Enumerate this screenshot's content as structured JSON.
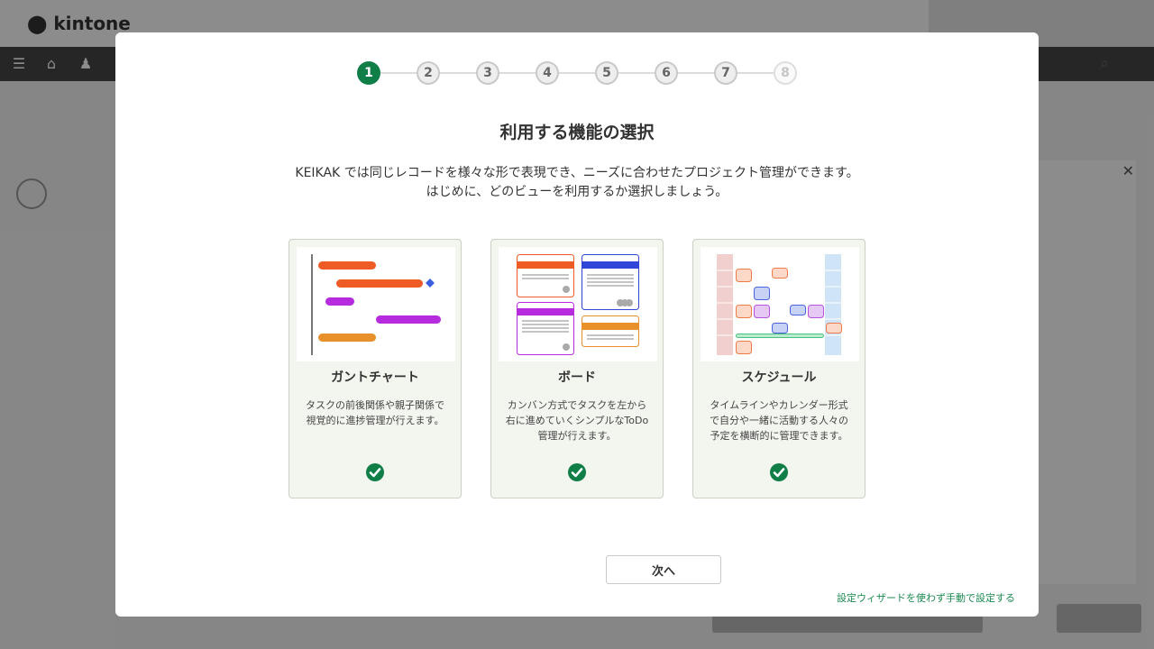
{
  "background": {
    "logo": "kintone",
    "user_name": "",
    "breadcrumb": "",
    "page_title": "",
    "section_label": "",
    "small_text": ""
  },
  "stepper": {
    "steps": [
      "1",
      "2",
      "3",
      "4",
      "5",
      "6",
      "7",
      "8"
    ],
    "current": 1
  },
  "modal": {
    "title": "利用する機能の選択",
    "desc_line1": "KEIKAK では同じレコードを様々な形で表現でき、ニーズに合わせたプロジェクト管理ができます。",
    "desc_line2": "はじめに、どのビューを利用するか選択しましょう。",
    "cards": [
      {
        "title": "ガントチャート",
        "desc_line1": "タスクの前後関係や親子関係で",
        "desc_line2": "視覚的に進捗管理が行えます。",
        "desc_line3": "",
        "icon": "gantt-chart-illustration",
        "selected": true
      },
      {
        "title": "ボード",
        "desc_line1": "カンバン方式でタスクを左から",
        "desc_line2": "右に進めていくシンプルなToDo",
        "desc_line3": "管理が行えます。",
        "icon": "kanban-board-illustration",
        "selected": true
      },
      {
        "title": "スケジュール",
        "desc_line1": "タイムラインやカレンダー形式",
        "desc_line2": "で自分や一緒に活動する人々の",
        "desc_line3": "予定を横断的に管理できます。",
        "icon": "schedule-illustration",
        "selected": true
      }
    ],
    "next_label": "次へ",
    "manual_link": "設定ウィザードを使わず手動で設定する"
  },
  "colors": {
    "accent_green": "#0f7e47",
    "gantt_orange": "#ef5b25",
    "gantt_purple": "#b72bdf",
    "gantt_amber": "#e8912a",
    "gantt_blue": "#3a5fe0",
    "board_blue": "#2f46d6",
    "schedule_pink": "#f2cfcf",
    "schedule_lightblue": "#cfe4f7",
    "schedule_green": "#4cc07f"
  }
}
